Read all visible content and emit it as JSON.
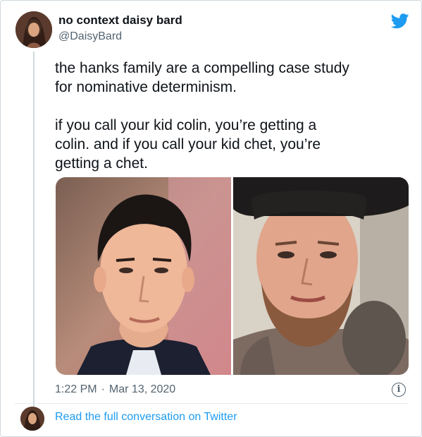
{
  "tweet": {
    "display_name": "no context daisy bard",
    "handle": "@DaisyBard",
    "paragraphs": [
      "the hanks family are a compelling case study\nfor nominative determinism.",
      "if you call your kid colin, you’re getting a\ncolin. and if you call your kid chet, you’re\ngetting a chet."
    ],
    "time": "1:22 PM",
    "separator": "·",
    "date": "Mar 13, 2020",
    "info_icon_glyph": "i",
    "read_more": "Read the full conversation on Twitter"
  },
  "icons": {
    "logo": "twitter-bird-icon",
    "info": "info-icon"
  },
  "colors": {
    "brand_blue": "#1d9bf0",
    "text_primary": "#0f1419",
    "text_secondary": "#536471",
    "border": "#cfd9de"
  },
  "media": {
    "count": 2,
    "photos": [
      "photo-1",
      "photo-2"
    ]
  }
}
